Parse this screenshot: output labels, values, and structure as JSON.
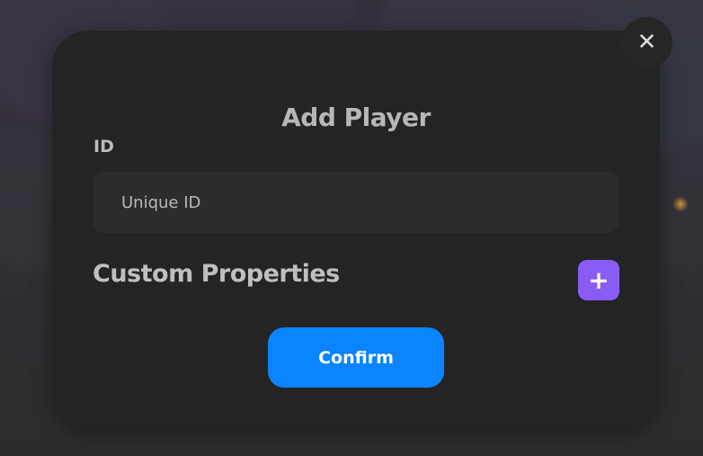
{
  "modal": {
    "title": "Add Player",
    "id_field": {
      "label": "ID",
      "value": "",
      "placeholder": "Unique ID"
    },
    "custom_properties": {
      "title": "Custom Properties",
      "add_icon": "plus-icon",
      "add_label": "+"
    },
    "confirm_label": "Confirm",
    "close_icon": "close-icon",
    "close_label": "✕"
  },
  "colors": {
    "modal_background": "#242424",
    "input_background": "#2c2c2c",
    "confirm_button": "#0a84ff",
    "add_button": "#8a5cf6",
    "close_button": "#262626",
    "text": "#bfbfbf"
  }
}
